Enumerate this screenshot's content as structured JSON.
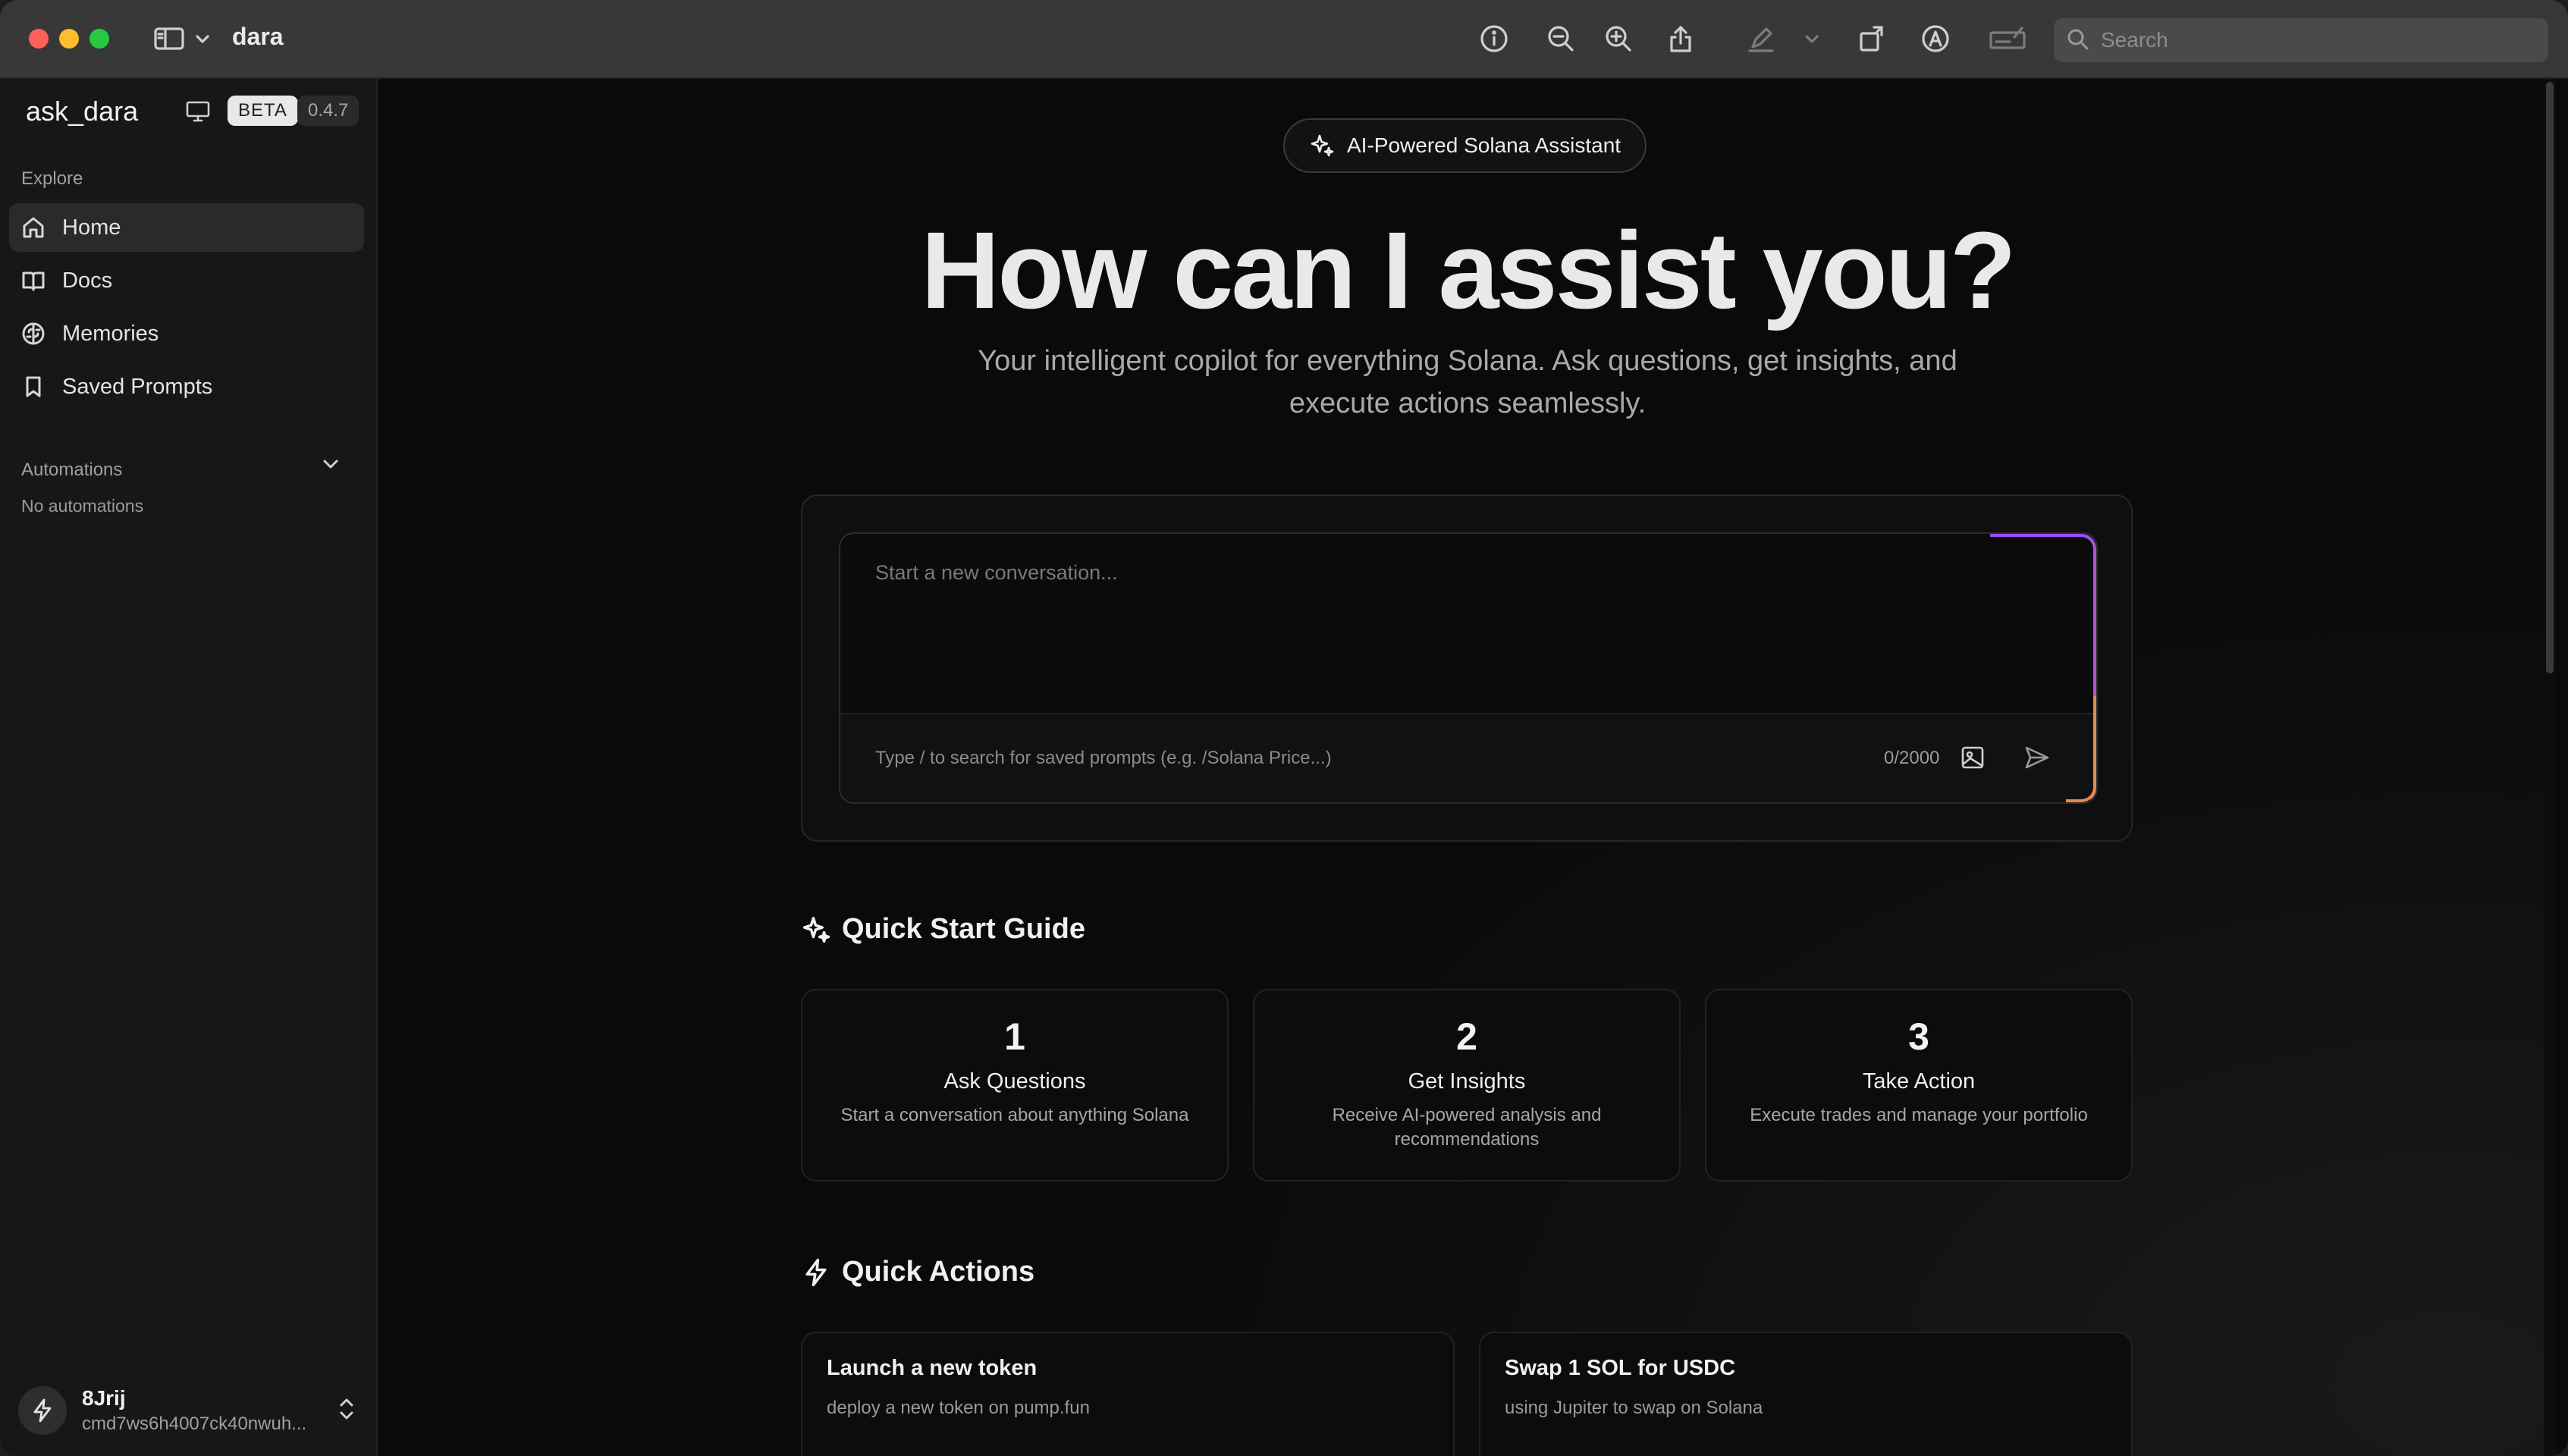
{
  "titlebar": {
    "title": "dara",
    "search_placeholder": "Search"
  },
  "sidebar": {
    "brand": "ask_dara",
    "badge": "BETA",
    "version": "0.4.7",
    "explore_label": "Explore",
    "items": [
      {
        "label": "Home",
        "icon": "home-icon",
        "active": true
      },
      {
        "label": "Docs",
        "icon": "book-icon",
        "active": false
      },
      {
        "label": "Memories",
        "icon": "brain-icon",
        "active": false
      },
      {
        "label": "Saved Prompts",
        "icon": "bookmark-icon",
        "active": false
      }
    ],
    "automations_label": "Automations",
    "automations_empty": "No automations",
    "user": {
      "name": "8Jrij",
      "id": "cmd7ws6h4007ck40nwuh..."
    }
  },
  "main": {
    "pill": "AI-Powered Solana Assistant",
    "hero": "How can I assist you?",
    "subtitle": "Your intelligent copilot for everything Solana. Ask questions, get insights, and execute actions seamlessly.",
    "composer": {
      "placeholder": "Start a new conversation...",
      "hint": "Type / to search for saved prompts (e.g. /Solana Price...)",
      "count": "0/2000"
    },
    "quick_start": {
      "title": "Quick Start Guide",
      "steps": [
        {
          "num": "1",
          "title": "Ask Questions",
          "desc": "Start a conversation about anything Solana"
        },
        {
          "num": "2",
          "title": "Get Insights",
          "desc": "Receive AI-powered analysis and recommendations"
        },
        {
          "num": "3",
          "title": "Take Action",
          "desc": "Execute trades and manage your portfolio"
        }
      ]
    },
    "quick_actions": {
      "title": "Quick Actions",
      "actions": [
        {
          "title": "Launch a new token",
          "desc": "deploy a new token on pump.fun"
        },
        {
          "title": "Swap 1 SOL for USDC",
          "desc": "using Jupiter to swap on Solana"
        }
      ]
    }
  },
  "colors": {
    "accent_purple": "#9b4dff",
    "accent_orange": "#e8894a",
    "background": "#0a0a0a",
    "sidebar": "#171717"
  }
}
